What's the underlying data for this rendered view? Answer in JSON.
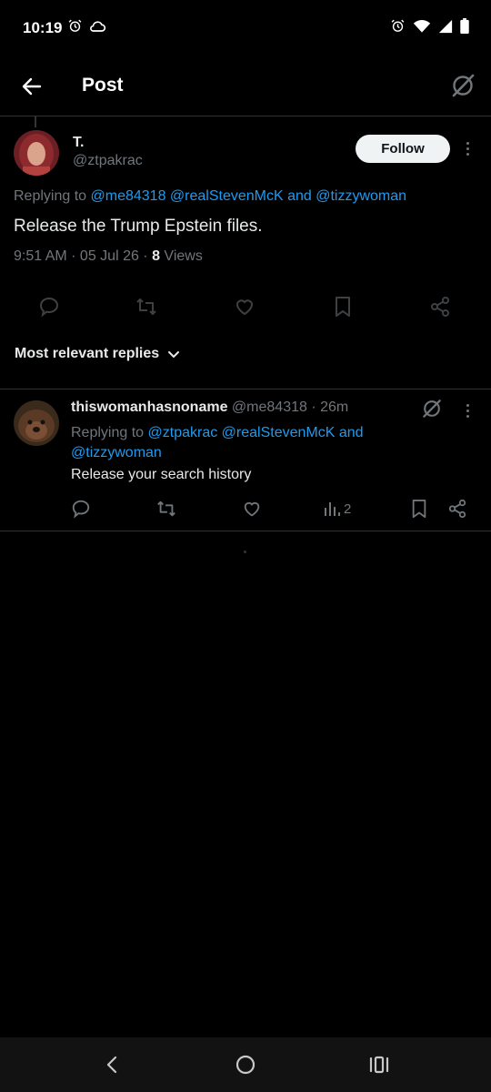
{
  "status_bar": {
    "time": "10:19"
  },
  "app_bar": {
    "title": "Post"
  },
  "post": {
    "name": "T.",
    "handle": "@ztpakrac",
    "follow_label": "Follow",
    "replying_prefix": "Replying to",
    "replying_to": "@me84318 @realStevenMcK and @tizzywoman",
    "text": "Release the Trump Epstein files.",
    "timestamp": "9:51 AM · 05 Jul 26 · ",
    "views_count": "8",
    "views_label": " Views"
  },
  "sort": {
    "label": "Most relevant replies"
  },
  "reply": {
    "name": "thiswomanhasnoname",
    "handle": " @me84318 · 26m",
    "replying_prefix": "Replying to",
    "replying_line1": "@ztpakrac @realStevenMcK and",
    "replying_line2": "@tizzywoman",
    "text": "Release your search history",
    "views_count": "2"
  },
  "colors": {
    "accent": "#1d9bf0",
    "muted": "#71767b",
    "divider": "#2f3336"
  }
}
